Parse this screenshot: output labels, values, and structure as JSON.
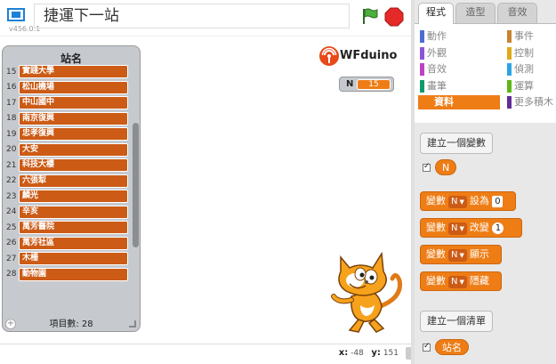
{
  "stage_header": {
    "version": "v456.0.1",
    "project_title": "捷運下一站"
  },
  "list_monitor": {
    "title": "站名",
    "rows": [
      {
        "index": "15",
        "value": "實踐大學"
      },
      {
        "index": "16",
        "value": "松山機場"
      },
      {
        "index": "17",
        "value": "中山國中"
      },
      {
        "index": "18",
        "value": "南京復興"
      },
      {
        "index": "19",
        "value": "忠孝復興"
      },
      {
        "index": "20",
        "value": "大安"
      },
      {
        "index": "21",
        "value": "科技大樓"
      },
      {
        "index": "22",
        "value": "六張犁"
      },
      {
        "index": "23",
        "value": "麟光"
      },
      {
        "index": "24",
        "value": "辛亥"
      },
      {
        "index": "25",
        "value": "萬芳醫院"
      },
      {
        "index": "26",
        "value": "萬芳社區"
      },
      {
        "index": "27",
        "value": "木柵"
      },
      {
        "index": "28",
        "value": "動物園"
      }
    ],
    "footer_label": "項目數: 28",
    "add_symbol": "+"
  },
  "logo": {
    "text": "WFduino"
  },
  "variable_monitor": {
    "name": "N",
    "value": "15"
  },
  "xy_readout": {
    "x_label": "x:",
    "x": "-48",
    "y_label": "y:",
    "y": "151"
  },
  "tabs": {
    "scripts": "程式",
    "costumes": "造型",
    "sounds": "音效"
  },
  "categories": [
    {
      "label": "動作",
      "color": "#4a6cd4"
    },
    {
      "label": "事件",
      "color": "#c88330"
    },
    {
      "label": "外觀",
      "color": "#8a55d7"
    },
    {
      "label": "控制",
      "color": "#e1a91a"
    },
    {
      "label": "音效",
      "color": "#bb42c3"
    },
    {
      "label": "偵測",
      "color": "#2ca5e2"
    },
    {
      "label": "畫筆",
      "color": "#0e9a6c"
    },
    {
      "label": "運算",
      "color": "#5cb712"
    },
    {
      "label": "資料",
      "color": "#ee7d16"
    },
    {
      "label": "更多積木",
      "color": "#632d99"
    }
  ],
  "palette": {
    "make_variable": "建立一個變數",
    "var_reporter": "N",
    "set_block": {
      "label": "變數",
      "var": "N",
      "op": "設為",
      "value": "0"
    },
    "change_block": {
      "label": "變數",
      "var": "N",
      "op": "改變",
      "value": "1"
    },
    "show_block": {
      "label": "變數",
      "var": "N",
      "op": "顯示"
    },
    "hide_block": {
      "label": "變數",
      "var": "N",
      "op": "隱藏"
    },
    "make_list": "建立一個清單",
    "list_reporter": "站名"
  },
  "colors": {
    "data_orange": "#ee7d16",
    "list_cell": "#cc5b16",
    "flag_green": "#4cae3c",
    "stop_red": "#e52828"
  }
}
